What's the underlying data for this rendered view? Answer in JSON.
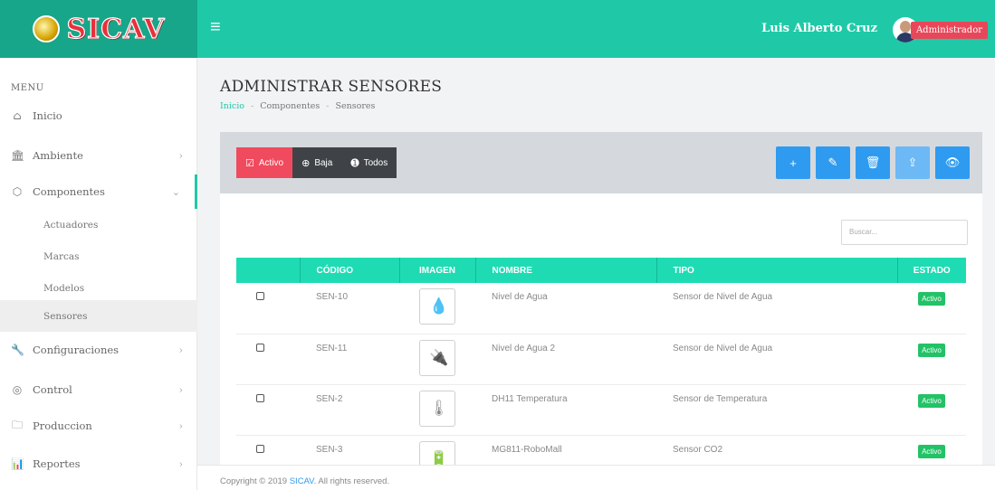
{
  "header": {
    "brand": "SICAV",
    "user_name": "Luis Alberto Cruz",
    "role": "Administrador",
    "menu_toggle_icon": "hamburger-icon"
  },
  "sidebar": {
    "menu_label": "MENU",
    "items": [
      {
        "label": "Inicio",
        "icon": "home-icon"
      },
      {
        "label": "Ambiente",
        "icon": "bank-icon"
      },
      {
        "label": "Componentes",
        "icon": "component-icon"
      },
      {
        "label": "Configuraciones",
        "icon": "wrench-icon"
      },
      {
        "label": "Control",
        "icon": "gauge-icon"
      },
      {
        "label": "Produccion",
        "icon": "folder-icon"
      },
      {
        "label": "Reportes",
        "icon": "chart-icon"
      }
    ],
    "subitems": [
      {
        "label": "Actuadores"
      },
      {
        "label": "Marcas"
      },
      {
        "label": "Modelos"
      },
      {
        "label": "Sensores"
      }
    ]
  },
  "page": {
    "title": "ADMINISTRAR SENSORES",
    "breadcrumb": [
      "Inicio",
      "Componentes",
      "Sensores"
    ],
    "breadcrumb_sep": "-"
  },
  "filters": [
    {
      "label": "Activo",
      "icon": "checkbox-icon"
    },
    {
      "label": "Baja",
      "icon": "circle-plus-icon"
    },
    {
      "label": "Todos",
      "icon": "circle-arrow-icon"
    }
  ],
  "actions": [
    "add-icon",
    "edit-icon",
    "delete-icon",
    "export-icon",
    "view-icon"
  ],
  "search": {
    "placeholder": "Buscar..."
  },
  "table": {
    "headers": [
      "",
      "CÓDIGO",
      "IMAGEN",
      "NOMBRE",
      "TIPO",
      "ESTADO"
    ],
    "rows": [
      {
        "code": "SEN-10",
        "name": "Nivel de Agua",
        "type": "Sensor de Nivel de Agua",
        "status": "Activo"
      },
      {
        "code": "SEN-11",
        "name": "Nivel de Agua 2",
        "type": "Sensor de Nivel de Agua",
        "status": "Activo"
      },
      {
        "code": "SEN-2",
        "name": "DH11 Temperatura",
        "type": "Sensor de Temperatura",
        "status": "Activo"
      },
      {
        "code": "SEN-3",
        "name": "MG811-RoboMall",
        "type": "Sensor CO2",
        "status": "Activo"
      }
    ]
  },
  "footer": {
    "prefix": "Copyright © 2019",
    "brand": "SICAV.",
    "suffix": "All rights reserved."
  },
  "colors": {
    "primary": "#1fc9a8",
    "danger": "#f04a5e",
    "info": "#2e9bf0",
    "success": "#23c267"
  }
}
